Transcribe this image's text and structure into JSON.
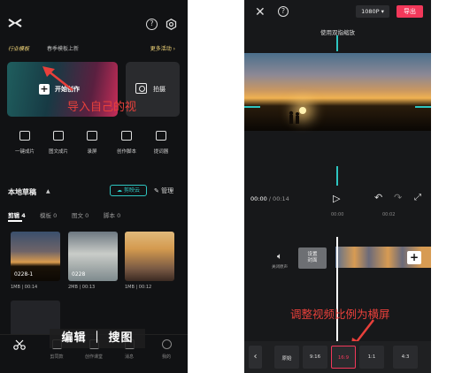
{
  "left_panel": {
    "logo_icon": "capcut-logo-icon",
    "promo": {
      "tag": "行业模板",
      "text": "春季模板上新",
      "more": "更多活动 ›"
    },
    "create_label": "开始创作",
    "shoot_label": "拍摄",
    "tools": [
      "一键成片",
      "图文成片",
      "录屏",
      "创作脚本",
      "提词器"
    ],
    "drafts_title": "本地草稿",
    "cloud_label": "☁ 剪映云",
    "manage_label": "✎ 管理",
    "tabs": [
      "剪辑 4",
      "模板 0",
      "图文 0",
      "脚本 0"
    ],
    "drafts": [
      {
        "name": "0228-1",
        "meta": "1MB | 00:14"
      },
      {
        "name": "0228",
        "meta": "2MB | 00:13"
      },
      {
        "name": "",
        "meta": "1MB | 00:12"
      }
    ],
    "nav": [
      "剪同款",
      "创作课堂",
      "消息",
      "我的"
    ],
    "caption": "编辑 ｜ 搜图",
    "annotation": "导入自己的视"
  },
  "right_panel": {
    "resolution": "1080P ▾",
    "export": "导出",
    "hint": "使用双指缩放",
    "time_current": "00:00",
    "time_total": " / 00:14",
    "ruler": [
      "00:00",
      "00:02"
    ],
    "mute_label": "关闭原声",
    "cover_label": "设置\n封面",
    "annotation": "调整视频比例为横屏",
    "ratios": [
      "原始",
      "9:16",
      "16:9",
      "1:1",
      "4:3"
    ],
    "selected_ratio": "16:9",
    "accent": "#f2385a",
    "guide_color": "#2ec5c1"
  }
}
